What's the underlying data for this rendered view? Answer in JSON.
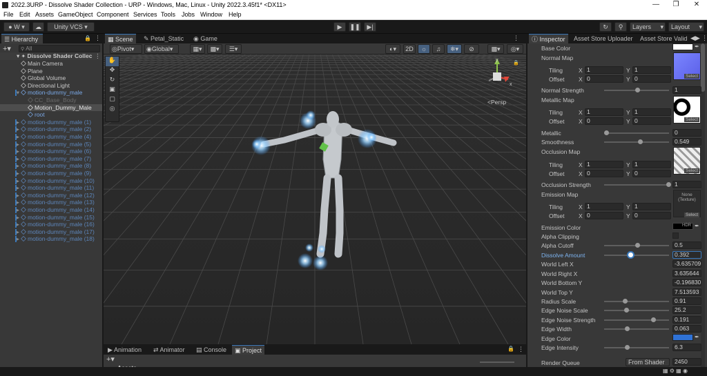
{
  "window": {
    "title": "2022.3URP - Dissolve Shader Collection - URP - Windows, Mac, Linux - Unity 2022.3.45f1* <DX11>"
  },
  "menu": [
    "File",
    "Edit",
    "Assets",
    "GameObject",
    "Component",
    "Services",
    "Tools",
    "Jobs",
    "Window",
    "Help"
  ],
  "toolbar": {
    "account": "W",
    "vcs": "Unity VCS",
    "layers": "Layers",
    "layout": "Layout"
  },
  "hierarchy": {
    "tab": "Hierarchy",
    "search_placeholder": "All",
    "scene_name": "Dissolve Shader Collec",
    "items": [
      {
        "label": "Main Camera",
        "indent": 1,
        "kind": "normal"
      },
      {
        "label": "Plane",
        "indent": 1,
        "kind": "normal"
      },
      {
        "label": "Global Volume",
        "indent": 1,
        "kind": "normal"
      },
      {
        "label": "Directional Light",
        "indent": 1,
        "kind": "normal"
      },
      {
        "label": "motion-dummy_male",
        "indent": 1,
        "kind": "prefab",
        "expanded": true
      },
      {
        "label": "CC_Base_Body",
        "indent": 2,
        "kind": "disabled"
      },
      {
        "label": "Motion_Dummy_Male",
        "indent": 2,
        "kind": "selected"
      },
      {
        "label": "root",
        "indent": 2,
        "kind": "prefab-child"
      },
      {
        "label": "motion-dummy_male (1)",
        "indent": 1,
        "kind": "prefab-dim"
      },
      {
        "label": "motion-dummy_male (2)",
        "indent": 1,
        "kind": "prefab-dim"
      },
      {
        "label": "motion-dummy_male (4)",
        "indent": 1,
        "kind": "prefab-dim"
      },
      {
        "label": "motion-dummy_male (5)",
        "indent": 1,
        "kind": "prefab-dim"
      },
      {
        "label": "motion-dummy_male (6)",
        "indent": 1,
        "kind": "prefab-dim"
      },
      {
        "label": "motion-dummy_male (7)",
        "indent": 1,
        "kind": "prefab-dim"
      },
      {
        "label": "motion-dummy_male (8)",
        "indent": 1,
        "kind": "prefab-dim"
      },
      {
        "label": "motion-dummy_male (9)",
        "indent": 1,
        "kind": "prefab-dim"
      },
      {
        "label": "motion-dummy_male (10)",
        "indent": 1,
        "kind": "prefab-dim"
      },
      {
        "label": "motion-dummy_male (11)",
        "indent": 1,
        "kind": "prefab-dim"
      },
      {
        "label": "motion-dummy_male (12)",
        "indent": 1,
        "kind": "prefab-dim"
      },
      {
        "label": "motion-dummy_male (13)",
        "indent": 1,
        "kind": "prefab-dim"
      },
      {
        "label": "motion-dummy_male (14)",
        "indent": 1,
        "kind": "prefab-dim"
      },
      {
        "label": "motion-dummy_male (15)",
        "indent": 1,
        "kind": "prefab-dim"
      },
      {
        "label": "motion-dummy_male (16)",
        "indent": 1,
        "kind": "prefab-dim"
      },
      {
        "label": "motion-dummy_male (17)",
        "indent": 1,
        "kind": "prefab-dim"
      },
      {
        "label": "motion-dummy_male (18)",
        "indent": 1,
        "kind": "prefab-dim"
      }
    ]
  },
  "scene": {
    "tabs": [
      "Scene",
      "Petal_Static",
      "Game"
    ],
    "pivot": "Pivot",
    "global": "Global",
    "mode_2d": "2D",
    "persp": "<Persp"
  },
  "inspector": {
    "tabs": [
      "Inspector",
      "Asset Store Uploader",
      "Asset Store Valid"
    ],
    "base_color": "Base Color",
    "normal_map": "Normal Map",
    "tiling": "Tiling",
    "offset": "Offset",
    "x": "X",
    "y": "Y",
    "normal": {
      "tiling_x": "1",
      "tiling_y": "1",
      "offset_x": "0",
      "offset_y": "0"
    },
    "normal_strength": {
      "label": "Normal Strength",
      "value": "1",
      "pos": 0.5
    },
    "metallic_map": "Metallic Map",
    "metallic_tex": {
      "tiling_x": "1",
      "tiling_y": "1",
      "offset_x": "0",
      "offset_y": "0"
    },
    "metallic": {
      "label": "Metallic",
      "value": "0",
      "pos": 0.0
    },
    "smoothness": {
      "label": "Smoothness",
      "value": "0.549",
      "pos": 0.549
    },
    "occlusion_map": "Occlusion Map",
    "occlusion_tex": {
      "tiling_x": "1",
      "tiling_y": "1",
      "offset_x": "0",
      "offset_y": "0"
    },
    "occlusion_strength": {
      "label": "Occlusion Strength",
      "value": "1",
      "pos": 1.0
    },
    "emission_map": "Emission Map",
    "emission_tex_label": "None (Texture)",
    "emission_tex": {
      "tiling_x": "1",
      "tiling_y": "1",
      "offset_x": "0",
      "offset_y": "0"
    },
    "emission_color": "Emission Color",
    "hdr": "HDR",
    "alpha_clipping": "Alpha Clipping",
    "alpha_cutoff": {
      "label": "Alpha Cutoff",
      "value": "0.5",
      "pos": 0.5
    },
    "dissolve_amount": {
      "label": "Dissolve Amount",
      "value": "0.392",
      "pos": 0.392
    },
    "world_left_x": {
      "label": "World Left X",
      "value": "-3.635709"
    },
    "world_right_x": {
      "label": "World Right X",
      "value": "3.635644"
    },
    "world_bottom_y": {
      "label": "World Bottom Y",
      "value": "-0.196830"
    },
    "world_top_y": {
      "label": "World Top Y",
      "value": "7.513593"
    },
    "radius_scale": {
      "label": "Radius Scale",
      "value": "0.91",
      "pos": 0.3
    },
    "edge_noise_scale": {
      "label": "Edge Noise Scale",
      "value": "25.2",
      "pos": 0.32
    },
    "edge_noise_strength": {
      "label": "Edge Noise Strength",
      "value": "0.191",
      "pos": 0.76
    },
    "edge_width": {
      "label": "Edge Width",
      "value": "0.063",
      "pos": 0.33
    },
    "edge_color": "Edge Color",
    "edge_intensity": {
      "label": "Edge Intensity",
      "value": "6.3",
      "pos": 0.33
    },
    "render_queue": {
      "label": "Render Queue",
      "mode": "From Shader",
      "value": "2450"
    },
    "select": "Select"
  },
  "bottom": {
    "tabs": [
      "Animation",
      "Animator",
      "Console",
      "Project"
    ],
    "assets": "Assets"
  },
  "colors": {
    "accent": "#3a79bb",
    "prefab": "#7aa8e6",
    "edge_color": "#2f72d6"
  }
}
